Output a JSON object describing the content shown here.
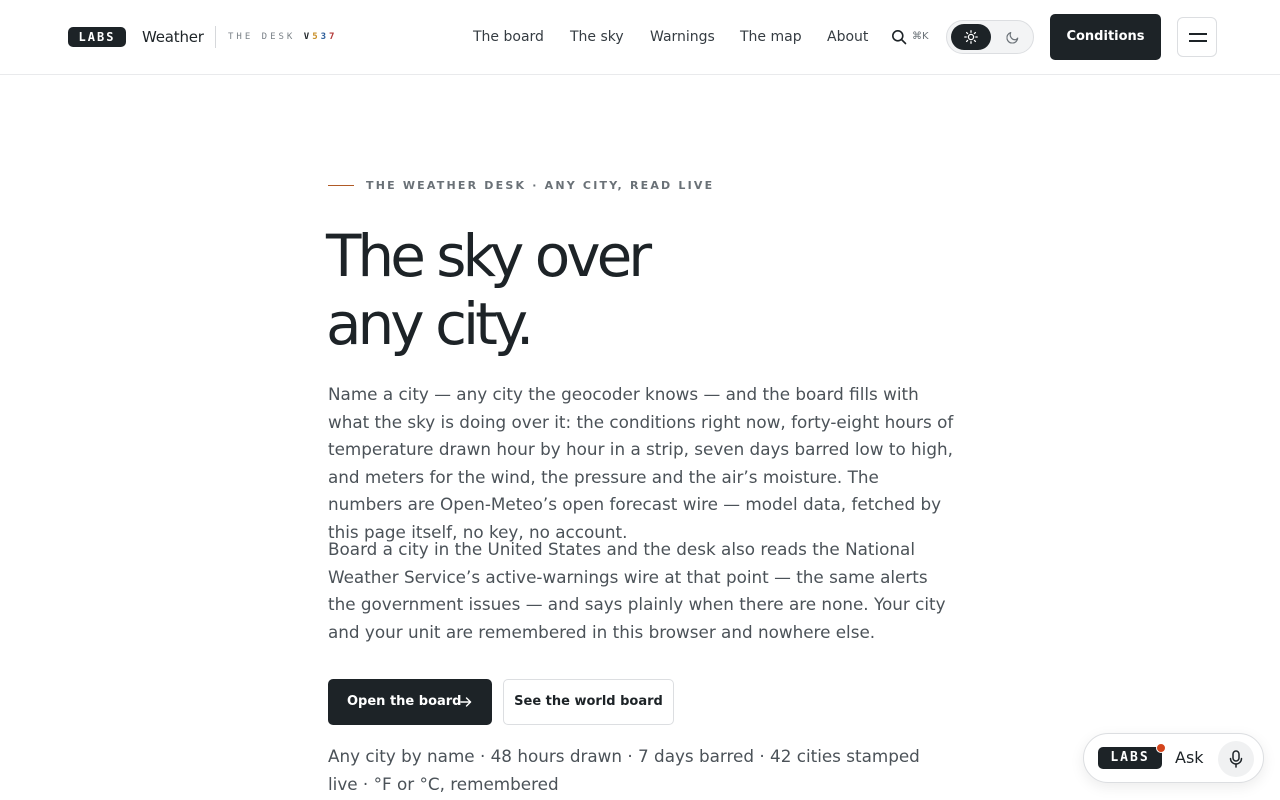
{
  "header": {
    "logo_text": "LABS",
    "brand": "Weather",
    "desk_tag": "THE DESK",
    "version": {
      "v": "V",
      "five": "5",
      "three": "3",
      "seven": "7"
    },
    "nav": [
      "The board",
      "The sky",
      "Warnings",
      "The map",
      "About"
    ],
    "search_shortcut": "⌘K",
    "theme_options": [
      "light",
      "dark"
    ],
    "theme_selected": "light",
    "cta_label": "Conditions"
  },
  "hero": {
    "eyebrow": "THE WEATHER DESK · ANY CITY, READ LIVE",
    "headline_line1": "The sky over",
    "headline_line2": "any city.",
    "paragraph1": "Name a city — any city the geocoder knows — and the board fills with what the sky is doing over it: the conditions right now, forty-eight hours of temperature drawn hour by hour in a strip, seven days barred low to high, and meters for the wind, the pressure and the air’s moisture. The numbers are Open-Meteo’s open forecast wire — model data, fetched by this page itself, no key, no account.",
    "paragraph2": "Board a city in the United States and the desk also reads the National Weather Service’s active-warnings wire at that point — the same alerts the government issues — and says plainly when there are none. Your city and your unit are remembered in this browser and nowhere else.",
    "primary_button": "Open the board",
    "secondary_button": "See the world board",
    "footnote": "Any city by name · 48 hours drawn · 7 days barred · 42 cities stamped live · °F or °C, remembered"
  },
  "ask_widget": {
    "logo_text": "LABS",
    "label": "Ask"
  },
  "colors": {
    "ink": "#1d2327",
    "accent_rule": "#b05a26",
    "notification_dot": "#d4441c"
  }
}
